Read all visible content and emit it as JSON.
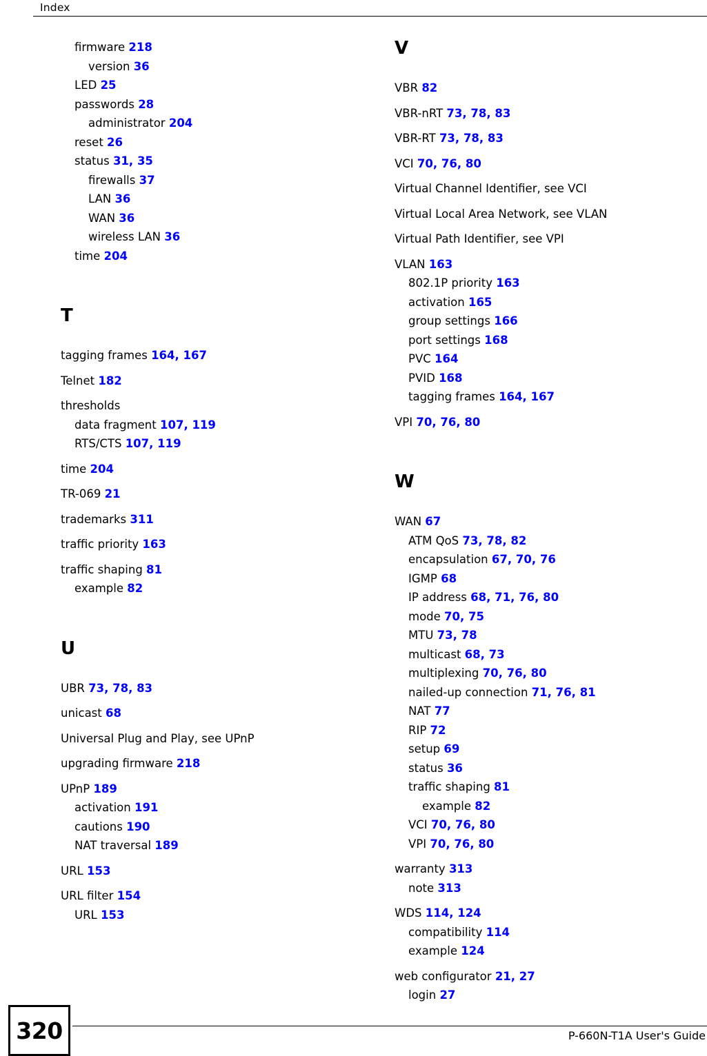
{
  "header": {
    "title": "Index"
  },
  "footer": {
    "page_number": "320",
    "guide_title": "P-660N-T1A User's Guide"
  },
  "colors": {
    "page_link": "#0000FF",
    "text": "#000000",
    "background": "#FFFFFF"
  },
  "columns": [
    {
      "id": "left",
      "blocks": [
        {
          "type": "entries",
          "entries": [
            {
              "term": "firmware",
              "pages": [
                "218"
              ],
              "level": 1
            },
            {
              "term": "version",
              "pages": [
                "36"
              ],
              "level": 2
            },
            {
              "term": "LED",
              "pages": [
                "25"
              ],
              "level": 1
            },
            {
              "term": "passwords",
              "pages": [
                "28"
              ],
              "level": 1
            },
            {
              "term": "administrator",
              "pages": [
                "204"
              ],
              "level": 2
            },
            {
              "term": "reset",
              "pages": [
                "26"
              ],
              "level": 1
            },
            {
              "term": "status",
              "pages": [
                "31",
                "35"
              ],
              "level": 1
            },
            {
              "term": "firewalls",
              "pages": [
                "37"
              ],
              "level": 2
            },
            {
              "term": "LAN",
              "pages": [
                "36"
              ],
              "level": 2
            },
            {
              "term": "WAN",
              "pages": [
                "36"
              ],
              "level": 2
            },
            {
              "term": "wireless LAN",
              "pages": [
                "36"
              ],
              "level": 2
            },
            {
              "term": "time",
              "pages": [
                "204"
              ],
              "level": 1
            }
          ]
        },
        {
          "type": "section",
          "letter": "T",
          "groups": [
            [
              {
                "term": "tagging frames",
                "pages": [
                  "164",
                  "167"
                ],
                "level": 0
              }
            ],
            [
              {
                "term": "Telnet",
                "pages": [
                  "182"
                ],
                "level": 0
              }
            ],
            [
              {
                "term": "thresholds",
                "pages": [],
                "level": 0
              },
              {
                "term": "data fragment",
                "pages": [
                  "107",
                  "119"
                ],
                "level": 1
              },
              {
                "term": "RTS/CTS",
                "pages": [
                  "107",
                  "119"
                ],
                "level": 1
              }
            ],
            [
              {
                "term": "time",
                "pages": [
                  "204"
                ],
                "level": 0
              }
            ],
            [
              {
                "term": "TR-069",
                "pages": [
                  "21"
                ],
                "level": 0
              }
            ],
            [
              {
                "term": "trademarks",
                "pages": [
                  "311"
                ],
                "level": 0
              }
            ],
            [
              {
                "term": "traffic priority",
                "pages": [
                  "163"
                ],
                "level": 0
              }
            ],
            [
              {
                "term": "traffic shaping",
                "pages": [
                  "81"
                ],
                "level": 0
              },
              {
                "term": "example",
                "pages": [
                  "82"
                ],
                "level": 1
              }
            ]
          ]
        },
        {
          "type": "section",
          "letter": "U",
          "groups": [
            [
              {
                "term": "UBR",
                "pages": [
                  "73",
                  "78",
                  "83"
                ],
                "level": 0
              }
            ],
            [
              {
                "term": "unicast",
                "pages": [
                  "68"
                ],
                "level": 0
              }
            ],
            [
              {
                "term": "Universal Plug and Play, see UPnP",
                "pages": [],
                "level": 0
              }
            ],
            [
              {
                "term": "upgrading firmware",
                "pages": [
                  "218"
                ],
                "level": 0
              }
            ],
            [
              {
                "term": "UPnP",
                "pages": [
                  "189"
                ],
                "level": 0
              },
              {
                "term": "activation",
                "pages": [
                  "191"
                ],
                "level": 1
              },
              {
                "term": "cautions",
                "pages": [
                  "190"
                ],
                "level": 1
              },
              {
                "term": "NAT traversal",
                "pages": [
                  "189"
                ],
                "level": 1
              }
            ],
            [
              {
                "term": "URL",
                "pages": [
                  "153"
                ],
                "level": 0
              }
            ],
            [
              {
                "term": "URL filter",
                "pages": [
                  "154"
                ],
                "level": 0
              },
              {
                "term": "URL",
                "pages": [
                  "153"
                ],
                "level": 1
              }
            ]
          ]
        }
      ]
    },
    {
      "id": "right",
      "blocks": [
        {
          "type": "section",
          "letter": "V",
          "first": true,
          "groups": [
            [
              {
                "term": "VBR",
                "pages": [
                  "82"
                ],
                "level": 0
              }
            ],
            [
              {
                "term": "VBR-nRT",
                "pages": [
                  "73",
                  "78",
                  "83"
                ],
                "level": 0
              }
            ],
            [
              {
                "term": "VBR-RT",
                "pages": [
                  "73",
                  "78",
                  "83"
                ],
                "level": 0
              }
            ],
            [
              {
                "term": "VCI",
                "pages": [
                  "70",
                  "76",
                  "80"
                ],
                "level": 0
              }
            ],
            [
              {
                "term": "Virtual Channel Identifier, see VCI",
                "pages": [],
                "level": 0
              }
            ],
            [
              {
                "term": "Virtual Local Area Network, see VLAN",
                "pages": [],
                "level": 0
              }
            ],
            [
              {
                "term": "Virtual Path Identifier, see VPI",
                "pages": [],
                "level": 0
              }
            ],
            [
              {
                "term": "VLAN",
                "pages": [
                  "163"
                ],
                "level": 0
              },
              {
                "term": "802.1P priority",
                "pages": [
                  "163"
                ],
                "level": 1
              },
              {
                "term": "activation",
                "pages": [
                  "165"
                ],
                "level": 1
              },
              {
                "term": "group settings",
                "pages": [
                  "166"
                ],
                "level": 1
              },
              {
                "term": "port settings",
                "pages": [
                  "168"
                ],
                "level": 1
              },
              {
                "term": "PVC",
                "pages": [
                  "164"
                ],
                "level": 1
              },
              {
                "term": "PVID",
                "pages": [
                  "168"
                ],
                "level": 1
              },
              {
                "term": "tagging frames",
                "pages": [
                  "164",
                  "167"
                ],
                "level": 1
              }
            ],
            [
              {
                "term": "VPI",
                "pages": [
                  "70",
                  "76",
                  "80"
                ],
                "level": 0
              }
            ]
          ]
        },
        {
          "type": "section",
          "letter": "W",
          "groups": [
            [
              {
                "term": "WAN",
                "pages": [
                  "67"
                ],
                "level": 0
              },
              {
                "term": "ATM QoS",
                "pages": [
                  "73",
                  "78",
                  "82"
                ],
                "level": 1
              },
              {
                "term": "encapsulation",
                "pages": [
                  "67",
                  "70",
                  "76"
                ],
                "level": 1
              },
              {
                "term": "IGMP",
                "pages": [
                  "68"
                ],
                "level": 1
              },
              {
                "term": "IP address",
                "pages": [
                  "68",
                  "71",
                  "76",
                  "80"
                ],
                "level": 1
              },
              {
                "term": "mode",
                "pages": [
                  "70",
                  "75"
                ],
                "level": 1
              },
              {
                "term": "MTU",
                "pages": [
                  "73",
                  "78"
                ],
                "level": 1
              },
              {
                "term": "multicast",
                "pages": [
                  "68",
                  "73"
                ],
                "level": 1
              },
              {
                "term": "multiplexing",
                "pages": [
                  "70",
                  "76",
                  "80"
                ],
                "level": 1
              },
              {
                "term": "nailed-up connection",
                "pages": [
                  "71",
                  "76",
                  "81"
                ],
                "level": 1
              },
              {
                "term": "NAT",
                "pages": [
                  "77"
                ],
                "level": 1
              },
              {
                "term": "RIP",
                "pages": [
                  "72"
                ],
                "level": 1
              },
              {
                "term": "setup",
                "pages": [
                  "69"
                ],
                "level": 1
              },
              {
                "term": "status",
                "pages": [
                  "36"
                ],
                "level": 1
              },
              {
                "term": "traffic shaping",
                "pages": [
                  "81"
                ],
                "level": 1
              },
              {
                "term": "example",
                "pages": [
                  "82"
                ],
                "level": 2
              },
              {
                "term": "VCI",
                "pages": [
                  "70",
                  "76",
                  "80"
                ],
                "level": 1
              },
              {
                "term": "VPI",
                "pages": [
                  "70",
                  "76",
                  "80"
                ],
                "level": 1
              }
            ],
            [
              {
                "term": "warranty",
                "pages": [
                  "313"
                ],
                "level": 0
              },
              {
                "term": "note",
                "pages": [
                  "313"
                ],
                "level": 1
              }
            ],
            [
              {
                "term": "WDS",
                "pages": [
                  "114",
                  "124"
                ],
                "level": 0
              },
              {
                "term": "compatibility",
                "pages": [
                  "114"
                ],
                "level": 1
              },
              {
                "term": "example",
                "pages": [
                  "124"
                ],
                "level": 1
              }
            ],
            [
              {
                "term": "web configurator",
                "pages": [
                  "21",
                  "27"
                ],
                "level": 0
              },
              {
                "term": "login",
                "pages": [
                  "27"
                ],
                "level": 1
              }
            ]
          ]
        }
      ]
    }
  ]
}
